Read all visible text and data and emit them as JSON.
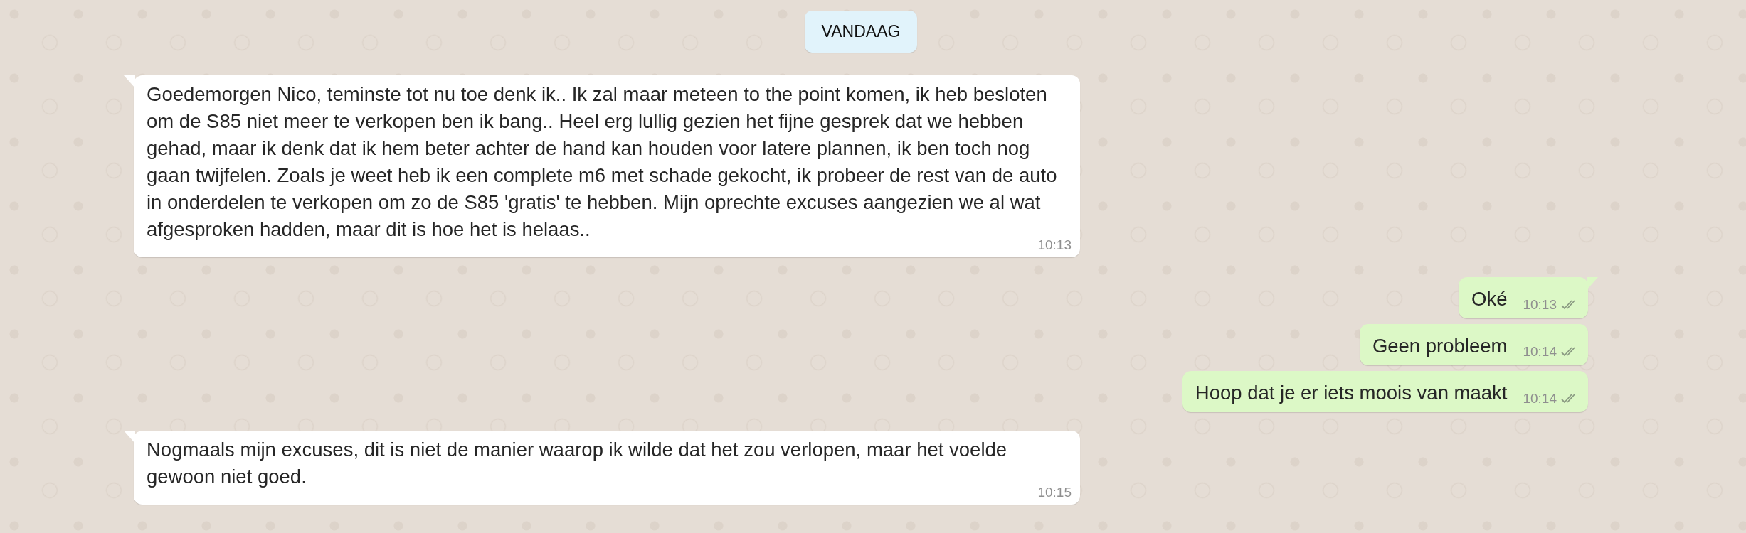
{
  "date_separator": "VANDAAG",
  "messages": [
    {
      "kind": "in",
      "text": "Goedemorgen Nico, teminste tot nu toe denk ik.. Ik zal maar meteen to the point komen, ik heb besloten om de S85 niet meer te verkopen ben ik bang.. Heel erg lullig gezien het fijne gesprek dat we hebben gehad, maar ik denk dat ik hem beter achter de hand kan houden voor latere plannen, ik ben toch nog gaan twijfelen. Zoals je weet heb ik een complete m6 met schade gekocht, ik probeer de rest van de auto in onderdelen te verkopen om zo de S85 'gratis' te hebben. Mijn oprechte excuses aangezien we al wat afgesproken hadden, maar dit is hoe het is helaas..",
      "time": "10:13"
    },
    {
      "kind": "out",
      "text": "Oké",
      "time": "10:13",
      "read": false
    },
    {
      "kind": "out",
      "text": "Geen probleem",
      "time": "10:14",
      "read": false
    },
    {
      "kind": "out",
      "text": "Hoop dat je er iets moois van maakt",
      "time": "10:14",
      "read": false
    },
    {
      "kind": "in",
      "text": "Nogmaals mijn excuses, dit is niet de manier waarop ik wilde dat het zou verlopen, maar het voelde gewoon niet goed.",
      "time": "10:15"
    }
  ]
}
